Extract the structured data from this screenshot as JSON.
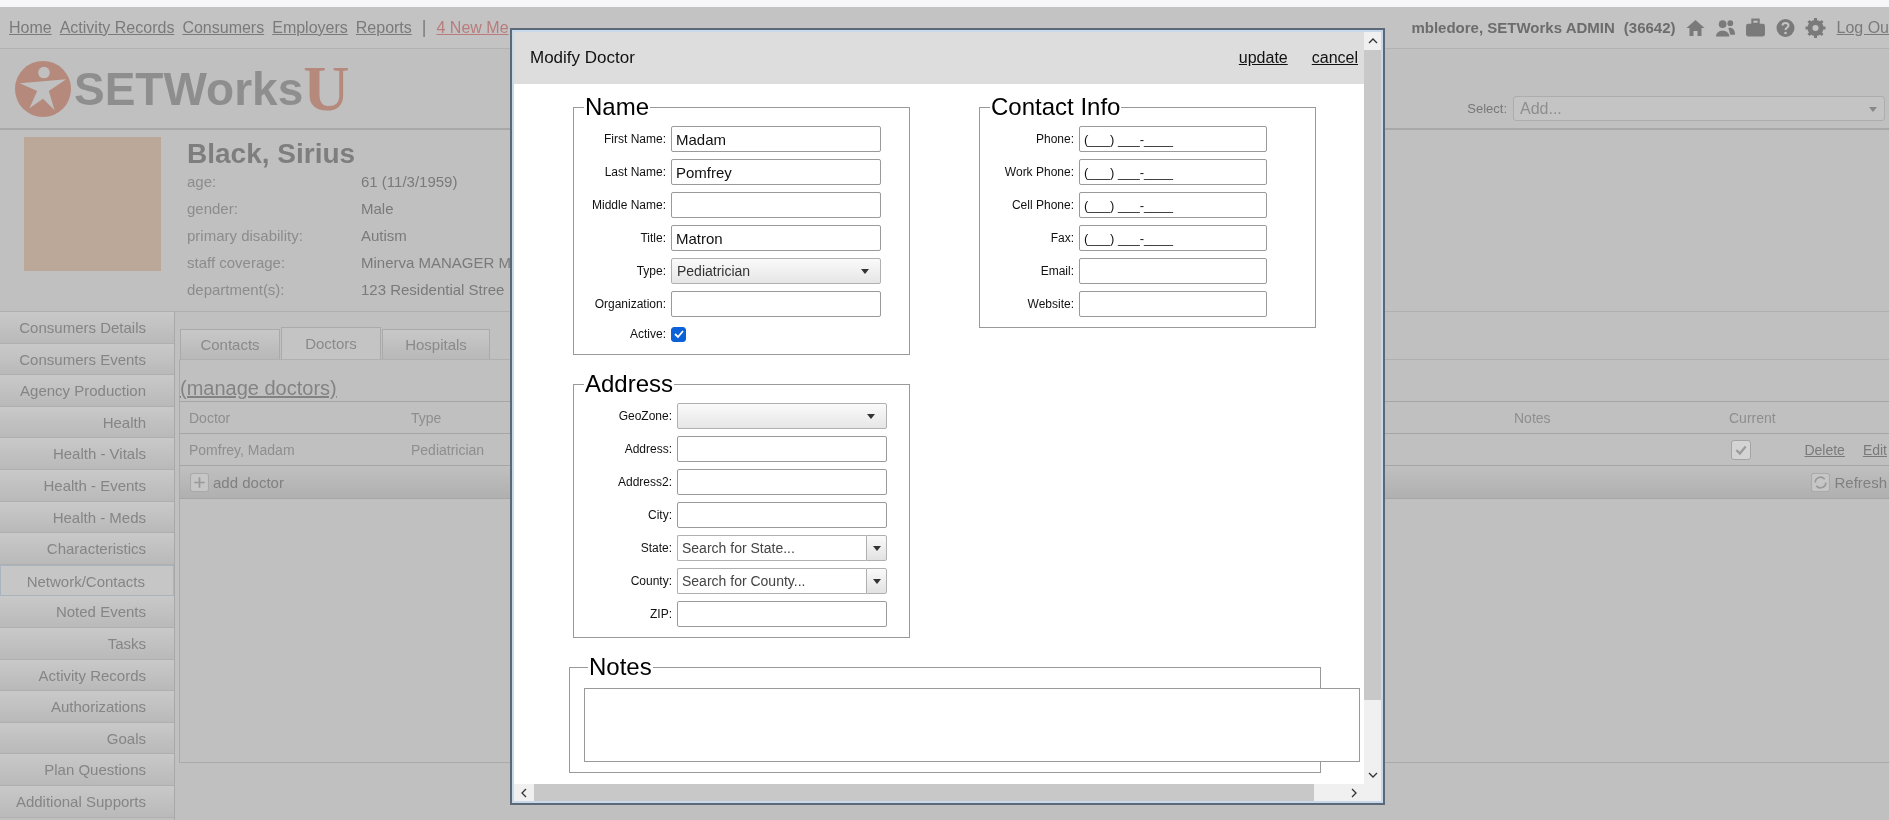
{
  "nav": {
    "links": [
      "Home",
      "Activity Records",
      "Consumers",
      "Employers",
      "Reports"
    ],
    "separator": "|",
    "alert": "4 New Me",
    "user": "mbledore, SETWorks ADMIN",
    "user_id": "(36642)",
    "logout": "Log Ou"
  },
  "logo": {
    "text": "SETWorks",
    "letter": "U"
  },
  "select": {
    "label": "Select:",
    "placeholder": "Add..."
  },
  "profile": {
    "name": "Black, Sirius",
    "fields": [
      {
        "label": "age:",
        "value": "61 (11/3/1959)"
      },
      {
        "label": "gender:",
        "value": "Male"
      },
      {
        "label": "primary disability:",
        "value": "Autism"
      },
      {
        "label": "staff coverage:",
        "value": "Minerva MANAGER M"
      },
      {
        "label": "department(s):",
        "value": "123 Residential Stree"
      }
    ]
  },
  "sidebar": {
    "items": [
      {
        "label": "Consumers Details",
        "selected": false
      },
      {
        "label": "Consumers Events",
        "selected": false
      },
      {
        "label": "Agency Production",
        "selected": false
      },
      {
        "label": "Health",
        "selected": false
      },
      {
        "label": "Health - Vitals",
        "selected": false
      },
      {
        "label": "Health - Events",
        "selected": false
      },
      {
        "label": "Health - Meds",
        "selected": false
      },
      {
        "label": "Characteristics",
        "selected": false
      },
      {
        "label": "Network/Contacts",
        "selected": true
      },
      {
        "label": "Noted Events",
        "selected": false
      },
      {
        "label": "Tasks",
        "selected": false
      },
      {
        "label": "Activity Records",
        "selected": false
      },
      {
        "label": "Authorizations",
        "selected": false
      },
      {
        "label": "Goals",
        "selected": false
      },
      {
        "label": "Plan Questions",
        "selected": false
      },
      {
        "label": "Additional Supports",
        "selected": false
      }
    ]
  },
  "tabs": [
    {
      "label": "Contacts",
      "selected": false
    },
    {
      "label": "Doctors",
      "selected": true
    },
    {
      "label": "Hospitals",
      "selected": false
    }
  ],
  "manage_link": "(manage doctors)",
  "table": {
    "columns": [
      "Doctor",
      "Type",
      "Notes",
      "Current"
    ],
    "rows": [
      {
        "cells": [
          "Pomfrey, Madam",
          "Pediatrician",
          ""
        ],
        "current": true,
        "actions": [
          "Delete",
          "Edit"
        ]
      }
    ]
  },
  "add_button": "add doctor",
  "refresh_button": "Refresh",
  "modal": {
    "title": "Modify Doctor",
    "actions": [
      "update",
      "cancel"
    ],
    "sections": [
      {
        "legend": "Name",
        "fields": [
          {
            "kind": "text",
            "label": "First Name:",
            "value": "Madam"
          },
          {
            "kind": "text",
            "label": "Last Name:",
            "value": "Pomfrey"
          },
          {
            "kind": "text",
            "label": "Middle Name:"
          },
          {
            "kind": "text",
            "label": "Title:",
            "value": "Matron"
          },
          {
            "kind": "select",
            "label": "Type:",
            "value": "Pediatrician"
          },
          {
            "kind": "text",
            "label": "Organization:"
          },
          {
            "kind": "checkbox",
            "label": "Active:",
            "checked": true
          }
        ]
      },
      {
        "legend": "Contact Info",
        "fields": [
          {
            "kind": "text",
            "label": "Phone:",
            "value": "(___) ___-____"
          },
          {
            "kind": "text",
            "label": "Work Phone:",
            "value": "(___) ___-____"
          },
          {
            "kind": "text",
            "label": "Cell Phone:",
            "value": "(___) ___-____"
          },
          {
            "kind": "text",
            "label": "Fax:",
            "value": "(___) ___-____"
          },
          {
            "kind": "text",
            "label": "Email:"
          },
          {
            "kind": "text",
            "label": "Website:"
          }
        ]
      },
      {
        "legend": "Address",
        "fields": [
          {
            "kind": "select",
            "label": "GeoZone:"
          },
          {
            "kind": "text",
            "label": "Address:"
          },
          {
            "kind": "text",
            "label": "Address2:"
          },
          {
            "kind": "text",
            "label": "City:"
          },
          {
            "kind": "combo",
            "label": "State:",
            "placeholder": "Search for State..."
          },
          {
            "kind": "combo",
            "label": "County:",
            "placeholder": "Search for County..."
          },
          {
            "kind": "text",
            "label": "ZIP:"
          }
        ]
      },
      {
        "legend": "Notes",
        "fields": [
          {
            "kind": "textarea"
          }
        ]
      }
    ]
  }
}
